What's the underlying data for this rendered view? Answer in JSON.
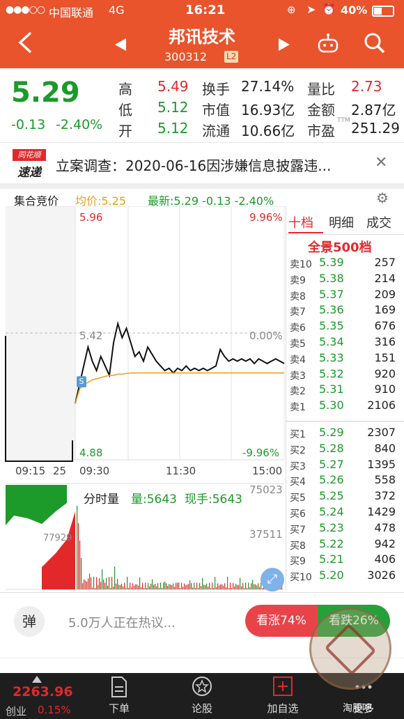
{
  "status_bar": {
    "carrier": "中国联通",
    "network": "4G",
    "time": "16:21",
    "battery": "40%"
  },
  "header": {
    "name": "邦讯技术",
    "code": "300312",
    "badge": "L2"
  },
  "quote": {
    "price": "5.29",
    "change": "-0.13",
    "change_pct": "-2.40%",
    "stats": [
      {
        "label": "高",
        "value": "5.49",
        "color": "red"
      },
      {
        "label": "换手",
        "value": "27.14%",
        "color": "dark"
      },
      {
        "label": "量比",
        "value": "2.73",
        "color": "red"
      },
      {
        "label": "低",
        "value": "5.12",
        "color": "green"
      },
      {
        "label": "市值",
        "value": "16.93亿",
        "color": "dark"
      },
      {
        "label": "金额",
        "value": "2.87亿",
        "color": "dark"
      },
      {
        "label": "开",
        "value": "5.12",
        "color": "green"
      },
      {
        "label": "流通",
        "value": "10.66亿",
        "color": "dark"
      },
      {
        "label": "市盈",
        "value": "251.29",
        "color": "dark"
      }
    ],
    "pe_suffix": "TTM"
  },
  "news": {
    "logo_top": "同花顺",
    "logo_bottom": "速递",
    "text": "立案调查：2020-06-16因涉嫌信息披露违..."
  },
  "chart_bar": {
    "label": "集合竞价",
    "avg": "均价:5.25",
    "latest": "最新:5.29 -0.13 -2.40%"
  },
  "chart_data": {
    "type": "line",
    "title": "",
    "y_price_top": "5.96",
    "y_price_mid": "5.42",
    "y_price_bottom": "4.88",
    "y_pct_top": "9.96%",
    "y_pct_mid": "0.00%",
    "y_pct_bottom": "-9.96%",
    "x_ticks": [
      "09:15",
      "25",
      "09:30",
      "11:30",
      "15:00"
    ],
    "ylim": [
      4.88,
      5.96
    ],
    "series": [
      {
        "values": [
          5.12,
          5.2,
          5.28,
          5.36,
          5.3,
          5.26,
          5.32,
          5.28,
          5.24,
          5.38,
          5.46,
          5.4,
          5.44,
          5.38,
          5.32,
          5.34,
          5.3,
          5.36,
          5.33,
          5.3,
          5.28,
          5.26,
          5.27,
          5.25,
          5.27,
          5.26,
          5.28,
          5.26,
          5.27,
          5.26,
          5.27,
          5.26,
          5.27,
          5.28,
          5.35,
          5.32,
          5.3,
          5.31,
          5.3,
          5.31,
          5.3,
          5.31,
          5.29,
          5.31,
          5.3,
          5.29,
          5.3,
          5.31,
          5.3,
          5.29
        ]
      },
      {
        "values": [
          5.12,
          5.18,
          5.2,
          5.21,
          5.22,
          5.225,
          5.23,
          5.235,
          5.24,
          5.24,
          5.245,
          5.245,
          5.248,
          5.25,
          5.25,
          5.25,
          5.25,
          5.25,
          5.25,
          5.25,
          5.25,
          5.25,
          5.25,
          5.25,
          5.25,
          5.25,
          5.25,
          5.25,
          5.25,
          5.25,
          5.25,
          5.25,
          5.25,
          5.25,
          5.25,
          5.25,
          5.25,
          5.25,
          5.25,
          5.25,
          5.25,
          5.25,
          5.25,
          5.25,
          5.25,
          5.25,
          5.25,
          5.25,
          5.25,
          5.25
        ]
      }
    ],
    "colors": {
      "price": "#111111",
      "avg": "#f0a020",
      "up": "#e3282c",
      "down": "#1c9a2a"
    }
  },
  "volume": {
    "label": "分时量",
    "vol": "量:5643",
    "cur": "现手:5643",
    "max": "75023",
    "mid": "37511",
    "auction_left": "77929"
  },
  "orderbook": {
    "tabs": [
      "十档",
      "明细",
      "成交"
    ],
    "banner": "全景500档",
    "asks": [
      {
        "label": "卖10",
        "price": "5.39",
        "vol": "257"
      },
      {
        "label": "卖9",
        "price": "5.38",
        "vol": "214"
      },
      {
        "label": "卖8",
        "price": "5.37",
        "vol": "209"
      },
      {
        "label": "卖7",
        "price": "5.36",
        "vol": "169"
      },
      {
        "label": "卖6",
        "price": "5.35",
        "vol": "676"
      },
      {
        "label": "卖5",
        "price": "5.34",
        "vol": "316"
      },
      {
        "label": "卖4",
        "price": "5.33",
        "vol": "151"
      },
      {
        "label": "卖3",
        "price": "5.32",
        "vol": "920"
      },
      {
        "label": "卖2",
        "price": "5.31",
        "vol": "910"
      },
      {
        "label": "卖1",
        "price": "5.30",
        "vol": "2106"
      }
    ],
    "bids": [
      {
        "label": "买1",
        "price": "5.29",
        "vol": "2307"
      },
      {
        "label": "买2",
        "price": "5.28",
        "vol": "840"
      },
      {
        "label": "买3",
        "price": "5.27",
        "vol": "1395"
      },
      {
        "label": "买4",
        "price": "5.26",
        "vol": "558"
      },
      {
        "label": "买5",
        "price": "5.25",
        "vol": "372"
      },
      {
        "label": "买6",
        "price": "5.24",
        "vol": "1429"
      },
      {
        "label": "买7",
        "price": "5.23",
        "vol": "478"
      },
      {
        "label": "买8",
        "price": "5.22",
        "vol": "942"
      },
      {
        "label": "买9",
        "price": "5.21",
        "vol": "406"
      },
      {
        "label": "买10",
        "price": "5.20",
        "vol": "3026"
      }
    ]
  },
  "comment_bar": {
    "danmu": "弹",
    "text": "5.0万人正在热议...",
    "up_label": "看涨74%",
    "down_label": "看跌26%",
    "up_pct": 74
  },
  "bottom_nav": {
    "index_value": "2263.96",
    "index_name": "创业",
    "index_change": "0.15%",
    "items": [
      "下单",
      "论股",
      "加自选",
      "更多"
    ]
  },
  "watermark": {
    "site": "淘股吧"
  }
}
